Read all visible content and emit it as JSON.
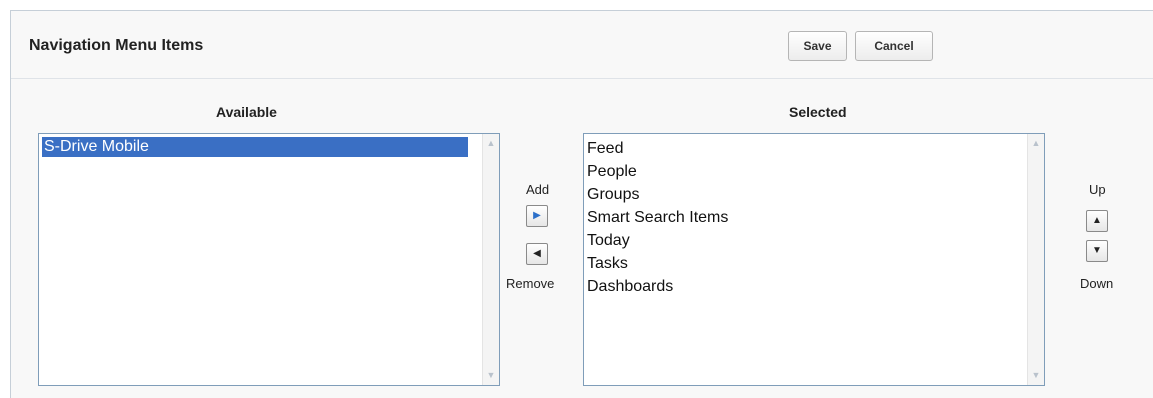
{
  "header": {
    "title": "Navigation Menu Items",
    "save_label": "Save",
    "cancel_label": "Cancel"
  },
  "available": {
    "label": "Available",
    "items": [
      "S-Drive Mobile"
    ],
    "selected_index": 0
  },
  "selected": {
    "label": "Selected",
    "items": [
      "Feed",
      "People",
      "Groups",
      "Smart Search Items",
      "Today",
      "Tasks",
      "Dashboards"
    ]
  },
  "controls": {
    "add_label": "Add",
    "remove_label": "Remove",
    "up_label": "Up",
    "down_label": "Down"
  },
  "icons": {
    "add": "right-triangle-icon",
    "remove": "left-triangle-icon",
    "up": "up-triangle-icon",
    "down": "down-triangle-icon",
    "add_color": "#2b6fc9"
  },
  "colors": {
    "selection": "#3a6fc4",
    "border": "#7f9db9",
    "panel_bg": "#f8f8f8"
  }
}
